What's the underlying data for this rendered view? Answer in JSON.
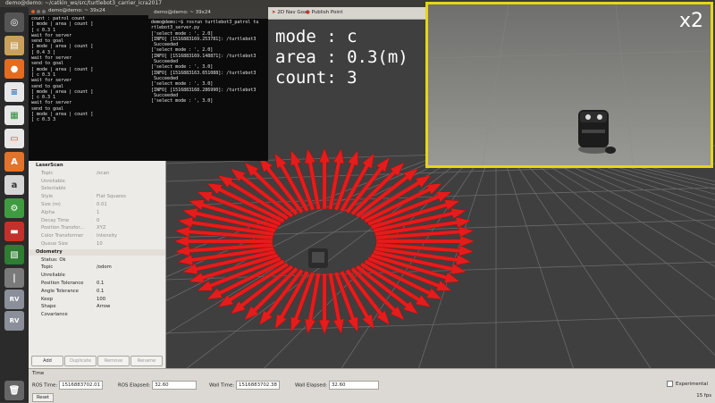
{
  "topbar": {
    "title": "demo@demo: ~/catkin_ws/src/turtlebot3_carrier_icra2017"
  },
  "launcher": {
    "icons": [
      "dash-icon",
      "files-icon",
      "firefox-icon",
      "writer-icon",
      "calc-icon",
      "impress-icon",
      "software-center-icon",
      "amazon-icon",
      "settings-icon",
      "terminal-icon",
      "image-viewer-icon",
      "rviz-icon",
      "rviz-icon-2",
      "workspaces-icon",
      "trash-icon"
    ]
  },
  "term1": {
    "title": "demo@demo: ~ 39x24",
    "lines": [
      "count : patrol count",
      "",
      "[ mode | area | count ]",
      "[ c 0.3 1",
      "wait for server",
      "send to goal",
      "[ mode | area | count ]",
      "[ 0.4 3 ]",
      "wait for server",
      "send to goal",
      "[ mode | area | count ]",
      "[ c 0.3 1",
      "wait for server",
      "send to goal",
      "[ mode | area | count ]",
      "[ c 0.3 1",
      "wait for server",
      "send to goal",
      "[ mode | area | count ]",
      "[ c 0.3 3"
    ]
  },
  "term2": {
    "title": "demo@demo: ~ 39x24",
    "lines": [
      "demo@demo:~$ rosrun turtlebot3_patrol tu",
      "rtlebot3_server.py",
      "['select mode : ', 2.0]",
      "[INFO] [1516883169.253781]: /turtlebot3",
      " Succeeded",
      "['select mode : ', 2.0]",
      "[INFO] [1516883169.148871]: /turtlebot3",
      " Succeeded",
      "['select mode : ', 3.0]",
      "[INFO] [1516883163.651088]: /turtlebot3",
      " Succeeded",
      "['select mode : ', 3.0]",
      "[INFO] [1516883168.286990]: /turtlebot3",
      " Succeeded",
      "['select mode : ', 3.0]"
    ]
  },
  "rviz_toolbar": {
    "nav_goal": "2D Nav Goal",
    "publish_point": "Publish Point"
  },
  "overlay": {
    "mode_line": "mode : c",
    "area_line": "area : 0.3(m)",
    "count_line": "count: 3"
  },
  "camera": {
    "zoom_label": "x2"
  },
  "displays": {
    "rows": [
      {
        "key": "LaserScan",
        "value": "",
        "style": "head"
      },
      {
        "key": "Topic",
        "value": "/scan",
        "style": "dim"
      },
      {
        "key": "Unreliable",
        "value": "",
        "style": "dim"
      },
      {
        "key": "Selectable",
        "value": "",
        "style": "dim"
      },
      {
        "key": "Style",
        "value": "Flat Squares",
        "style": "dim"
      },
      {
        "key": "Size (m)",
        "value": "0.01",
        "style": "dim"
      },
      {
        "key": "Alpha",
        "value": "1",
        "style": "dim"
      },
      {
        "key": "Decay Time",
        "value": "0",
        "style": "dim"
      },
      {
        "key": "Position Transfor...",
        "value": "XYZ",
        "style": "dim"
      },
      {
        "key": "Color Transformer",
        "value": "Intensity",
        "style": "dim"
      },
      {
        "key": "Queue Size",
        "value": "10",
        "style": "dim"
      },
      {
        "key": "Odometry",
        "value": "",
        "style": "head2"
      },
      {
        "key": "Status: Ok",
        "value": "",
        "style": "status"
      },
      {
        "key": "Topic",
        "value": "/odom",
        "style": "l2"
      },
      {
        "key": "Unreliable",
        "value": "",
        "style": "l2"
      },
      {
        "key": "Position Tolerance",
        "value": "0.1",
        "style": "l2"
      },
      {
        "key": "Angle Tolerance",
        "value": "0.1",
        "style": "l2"
      },
      {
        "key": "Keep",
        "value": "100",
        "style": "l2"
      },
      {
        "key": "Shape",
        "value": "Arrow",
        "style": "l2"
      },
      {
        "key": "Covariance",
        "value": "",
        "style": "l2"
      }
    ],
    "buttons": {
      "add": "Add",
      "duplicate": "Duplicate",
      "remove": "Remove",
      "rename": "Rename"
    }
  },
  "timebar": {
    "title": "Time",
    "ros_time_label": "ROS Time:",
    "ros_time_value": "1516883702.01",
    "ros_elapsed_label": "ROS Elapsed:",
    "ros_elapsed_value": "32.60",
    "wall_time_label": "Wall Time:",
    "wall_time_value": "1516883702.38",
    "wall_elapsed_label": "Wall Elapsed:",
    "wall_elapsed_value": "32.60",
    "experimental_label": "Experimental",
    "reset_label": "Reset",
    "fps_label": "15 fps"
  },
  "colors": {
    "arrow": "#e51c1c",
    "camera_border": "#e6d51a",
    "grid": "#6a6a6a"
  }
}
